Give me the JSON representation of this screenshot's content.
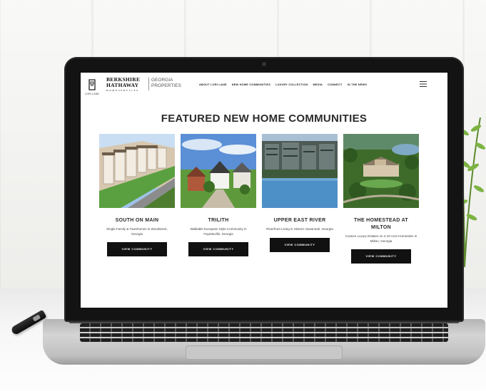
{
  "site": {
    "logo_small_text": "LORI LANE",
    "brand": {
      "line1": "BERKSHIRE",
      "line2": "HATHAWAY",
      "line3": "HOMESERVICES",
      "region_line1": "GEORGIA",
      "region_line2": "PROPERTIES"
    },
    "nav": [
      "ABOUT LORI LANE",
      "NEW HOME COMMUNITIES",
      "LUXURY COLLECTION",
      "MEDIA",
      "CONNECT",
      "IN THE NEWS"
    ],
    "section_title": "FEATURED NEW HOME COMMUNITIES",
    "communities": [
      {
        "name": "SOUTH ON MAIN",
        "description": "Single Family & Townhomes in Woodstock, Georgia",
        "button": "VIEW COMMUNITY",
        "image_icon": "townhomes-photo"
      },
      {
        "name": "TRILITH",
        "description": "Walkable European Style Community in Fayetteville, Georgia",
        "button": "VIEW COMMUNITY",
        "image_icon": "village-photo"
      },
      {
        "name": "UPPER EAST RIVER",
        "description": "Riverfront Living in Historic Savannah, Georgia",
        "button": "VIEW COMMUNITY",
        "image_icon": "riverfront-photo"
      },
      {
        "name": "THE HOMESTEAD AT MILTON",
        "description": "Custom Luxury Estates on 4-10 Acre Homesites in Milton, Georgia",
        "button": "VIEW COMMUNITY",
        "image_icon": "estate-photo"
      }
    ]
  },
  "colors": {
    "button_bg": "#111111",
    "text_dark": "#2b2b2b",
    "laptop_bezel": "#131313"
  }
}
